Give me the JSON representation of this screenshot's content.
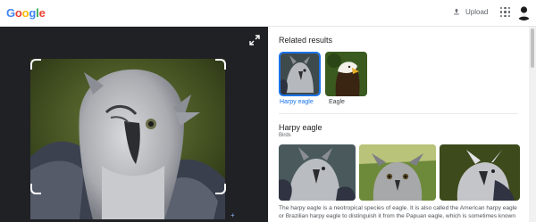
{
  "header": {
    "logo_letters": [
      {
        "char": "G",
        "color": "#4285F4"
      },
      {
        "char": "o",
        "color": "#EA4335"
      },
      {
        "char": "o",
        "color": "#FBBC05"
      },
      {
        "char": "g",
        "color": "#4285F4"
      },
      {
        "char": "l",
        "color": "#34A853"
      },
      {
        "char": "e",
        "color": "#EA4335"
      }
    ],
    "upload_label": "Upload",
    "upload_icon": "upload-icon",
    "apps_icon": "apps-grid-icon"
  },
  "related": {
    "title": "Related results",
    "items": [
      {
        "label": "Harpy eagle",
        "selected": true
      },
      {
        "label": "Eagle",
        "selected": false
      }
    ]
  },
  "entity": {
    "title": "Harpy eagle",
    "subtitle": "Birds",
    "description": "The harpy eagle is a neotropical species of eagle. It is also called the American harpy eagle or Brazilian harpy eagle to distinguish it from the Papuan eagle, which is sometimes known as the"
  },
  "colors": {
    "accent": "#1a73e8",
    "viewer_bg": "#202124"
  }
}
